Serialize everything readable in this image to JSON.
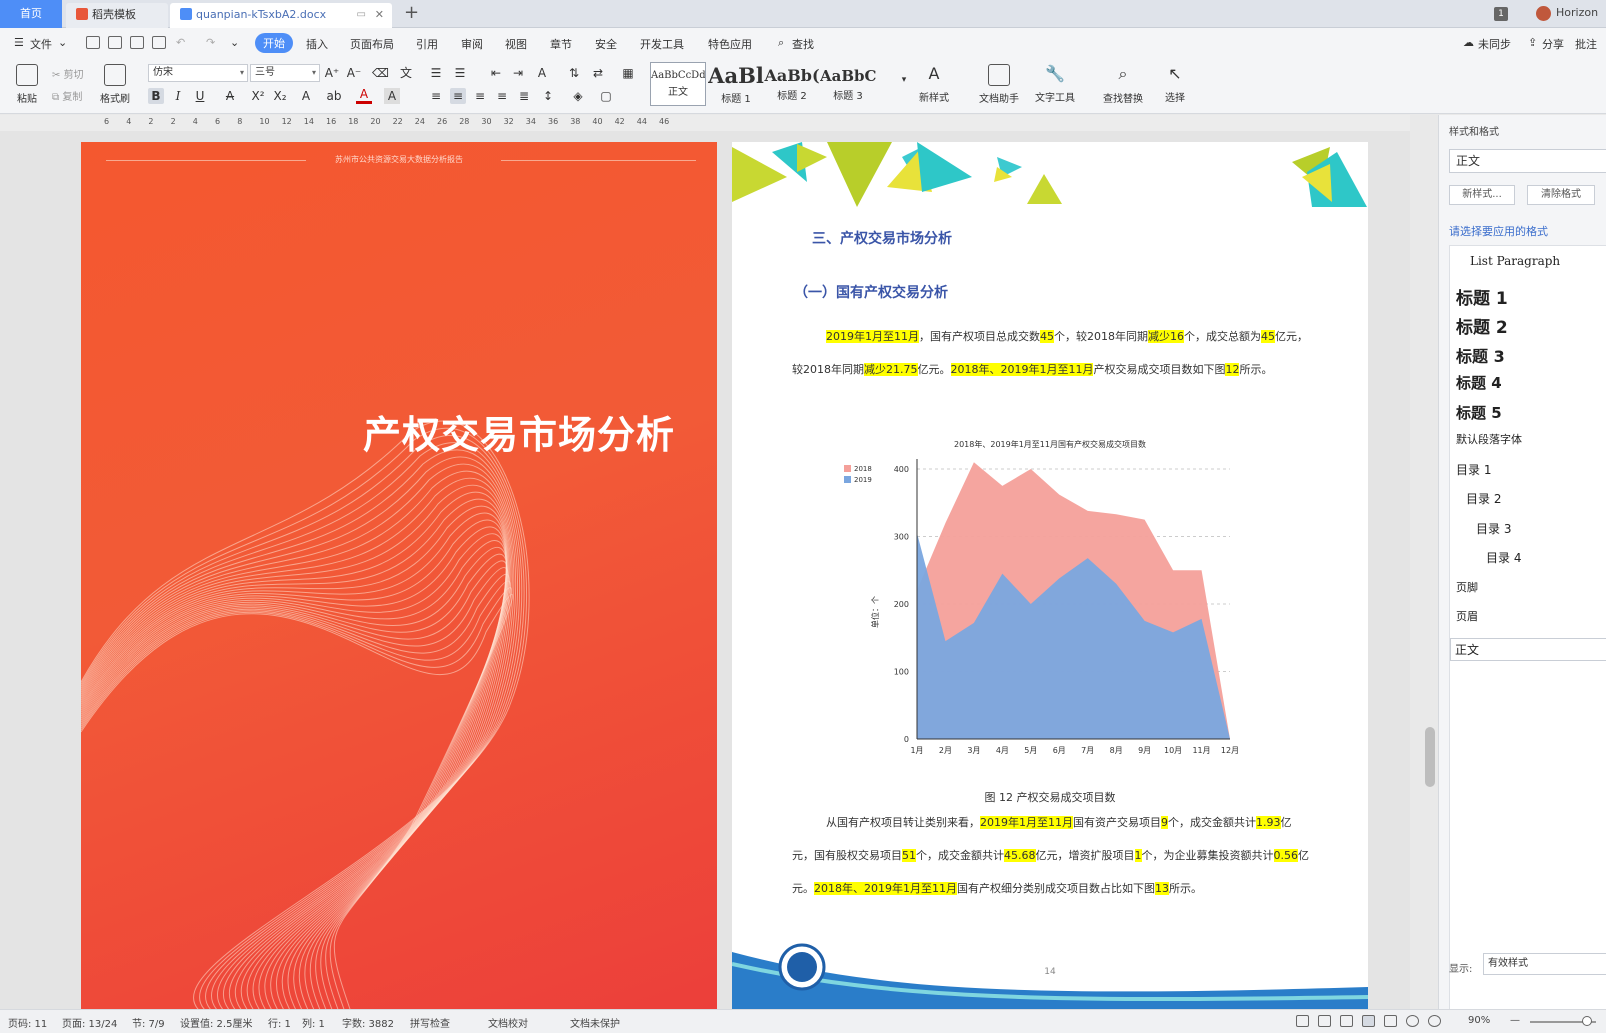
{
  "tabs": {
    "home": "首页",
    "template": "稻壳模板",
    "doc": "quanpian-kTsxbA2.docx"
  },
  "titlebar": {
    "badge": "1",
    "user": "Horizon"
  },
  "menu": {
    "file": "文件",
    "items": [
      "开始",
      "插入",
      "页面布局",
      "引用",
      "审阅",
      "视图",
      "章节",
      "安全",
      "开发工具",
      "特色应用"
    ],
    "active": "开始",
    "search": "查找",
    "sync": "未同步",
    "share": "分享",
    "comment": "批注"
  },
  "ribbon": {
    "paste": "粘贴",
    "cut": "剪切",
    "copy": "复制",
    "format_painter": "格式刷",
    "font_name": "仿宋",
    "font_size": "三号",
    "styles": [
      {
        "preview": "AaBbCcDd",
        "label": "正文"
      },
      {
        "preview": "AaBl",
        "label": "标题 1"
      },
      {
        "preview": "AaBb(",
        "label": "标题 2"
      },
      {
        "preview": "AaBbC(",
        "label": "标题 3"
      }
    ],
    "new_style": "新样式",
    "doc_helper": "文档助手",
    "text_tools": "文字工具",
    "find_replace": "查找替换",
    "select": "选择"
  },
  "ruler": [
    "6",
    "4",
    "2",
    "2",
    "4",
    "6",
    "8",
    "10",
    "12",
    "14",
    "16",
    "18",
    "20",
    "22",
    "24",
    "26",
    "28",
    "30",
    "32",
    "34",
    "36",
    "38",
    "40",
    "42",
    "44",
    "46"
  ],
  "cover": {
    "header": "苏州市公共资源交易大数据分析报告",
    "title": "产权交易市场分析"
  },
  "page": {
    "heading1": "三、产权交易市场分析",
    "heading2": "（一）国有产权交易分析",
    "p1": [
      {
        "t": "2019年1月至11月",
        "hl": true
      },
      {
        "t": "，国有产权项目总成交数",
        "hl": false
      },
      {
        "t": "45",
        "hl": true
      },
      {
        "t": "个，较2018年同期",
        "hl": false
      },
      {
        "t": "减少16",
        "hl": true
      },
      {
        "t": "个，成交总额为",
        "hl": false
      },
      {
        "t": "45",
        "hl": true
      },
      {
        "t": "亿元，较2018年同期",
        "hl": false
      },
      {
        "t": "减少21.75",
        "hl": true
      },
      {
        "t": "亿元。",
        "hl": false
      },
      {
        "t": "2018年、2019年1月至11月",
        "hl": true
      },
      {
        "t": "产权交易成交项目数如下图",
        "hl": false
      },
      {
        "t": "12",
        "hl": true
      },
      {
        "t": "所示。",
        "hl": false
      }
    ],
    "caption": "图 12 产权交易成交项目数",
    "p2": [
      {
        "t": "从国有产权项目转让类别来看，",
        "hl": false
      },
      {
        "t": "2019年1月至11月",
        "hl": true
      },
      {
        "t": "国有资产交易项目",
        "hl": false
      },
      {
        "t": "9",
        "hl": true
      },
      {
        "t": "个，成交金额共计",
        "hl": false
      },
      {
        "t": "1.93",
        "hl": true
      },
      {
        "t": "亿元，国有股权交易项目",
        "hl": false
      },
      {
        "t": "51",
        "hl": true
      },
      {
        "t": "个，成交金额共计",
        "hl": false
      },
      {
        "t": "45.68",
        "hl": true
      },
      {
        "t": "亿元，增资扩股项目",
        "hl": false
      },
      {
        "t": "1",
        "hl": true
      },
      {
        "t": "个，为企业募集投资额共计",
        "hl": false
      },
      {
        "t": "0.56",
        "hl": true
      },
      {
        "t": "亿元。",
        "hl": false
      },
      {
        "t": "2018年、2019年1月至11月",
        "hl": true
      },
      {
        "t": "国有产权细分类别成交项目数占比如下图",
        "hl": false
      },
      {
        "t": "13",
        "hl": true
      },
      {
        "t": "所示。",
        "hl": false
      }
    ],
    "page_number": "14"
  },
  "chart_data": {
    "type": "area",
    "title": "2018年、2019年1月至11月国有产权交易成交项目数",
    "ylabel": "单位：个",
    "categories": [
      "1月",
      "2月",
      "3月",
      "4月",
      "5月",
      "6月",
      "7月",
      "8月",
      "9月",
      "10月",
      "11月",
      "12月"
    ],
    "ylim": [
      0,
      400
    ],
    "yticks": [
      0,
      100,
      200,
      300,
      400
    ],
    "series": [
      {
        "name": "2018",
        "color": "#f4a09a",
        "values": [
          220,
          320,
          410,
          375,
          400,
          362,
          338,
          333,
          325,
          250,
          250,
          0
        ]
      },
      {
        "name": "2019",
        "color": "#7aa6df",
        "values": [
          305,
          145,
          172,
          245,
          200,
          238,
          268,
          230,
          175,
          158,
          178,
          0
        ]
      }
    ],
    "legend": "top-left",
    "grid": true
  },
  "pane": {
    "title": "样式和格式",
    "current": "正文",
    "new_style": "新样式...",
    "clear": "清除格式",
    "hint": "请选择要应用的格式",
    "styles": [
      {
        "label": "List Paragraph",
        "size": 12,
        "bold": false,
        "indent": 14,
        "serif": true
      },
      {
        "label": "标题 1",
        "size": 17,
        "bold": true,
        "indent": 0,
        "serif": false
      },
      {
        "label": "标题 2",
        "size": 17,
        "bold": true,
        "indent": 0,
        "serif": false
      },
      {
        "label": "标题 3",
        "size": 16,
        "bold": true,
        "indent": 0,
        "serif": false
      },
      {
        "label": "标题 4",
        "size": 15,
        "bold": true,
        "indent": 0,
        "serif": false
      },
      {
        "label": "标题 5",
        "size": 15,
        "bold": true,
        "indent": 0,
        "serif": false
      },
      {
        "label": "默认段落字体",
        "size": 11,
        "bold": false,
        "indent": 0,
        "serif": false
      },
      {
        "label": "目录 1",
        "size": 12,
        "bold": false,
        "indent": 0,
        "serif": false
      },
      {
        "label": "目录 2",
        "size": 12,
        "bold": false,
        "indent": 10,
        "serif": false
      },
      {
        "label": "目录 3",
        "size": 12,
        "bold": false,
        "indent": 20,
        "serif": false
      },
      {
        "label": "目录 4",
        "size": 12,
        "bold": false,
        "indent": 30,
        "serif": false
      },
      {
        "label": "页脚",
        "size": 11,
        "bold": false,
        "indent": 0,
        "serif": false
      },
      {
        "label": "页眉",
        "size": 11,
        "bold": false,
        "indent": 0,
        "serif": false
      },
      {
        "label": "正文",
        "size": 12,
        "bold": false,
        "indent": 0,
        "serif": false,
        "boxed": true
      }
    ],
    "show_label": "显示:",
    "show_value": "有效样式"
  },
  "status": {
    "page_code": "页码: 11",
    "page": "页面: 13/24",
    "section": "节: 7/9",
    "setting": "设置值: 2.5厘米",
    "row": "行: 1",
    "col": "列: 1",
    "words": "字数: 3882",
    "spell": "拼写检查",
    "proof": "文档校对",
    "protect": "文档未保护",
    "zoom": "90%"
  }
}
